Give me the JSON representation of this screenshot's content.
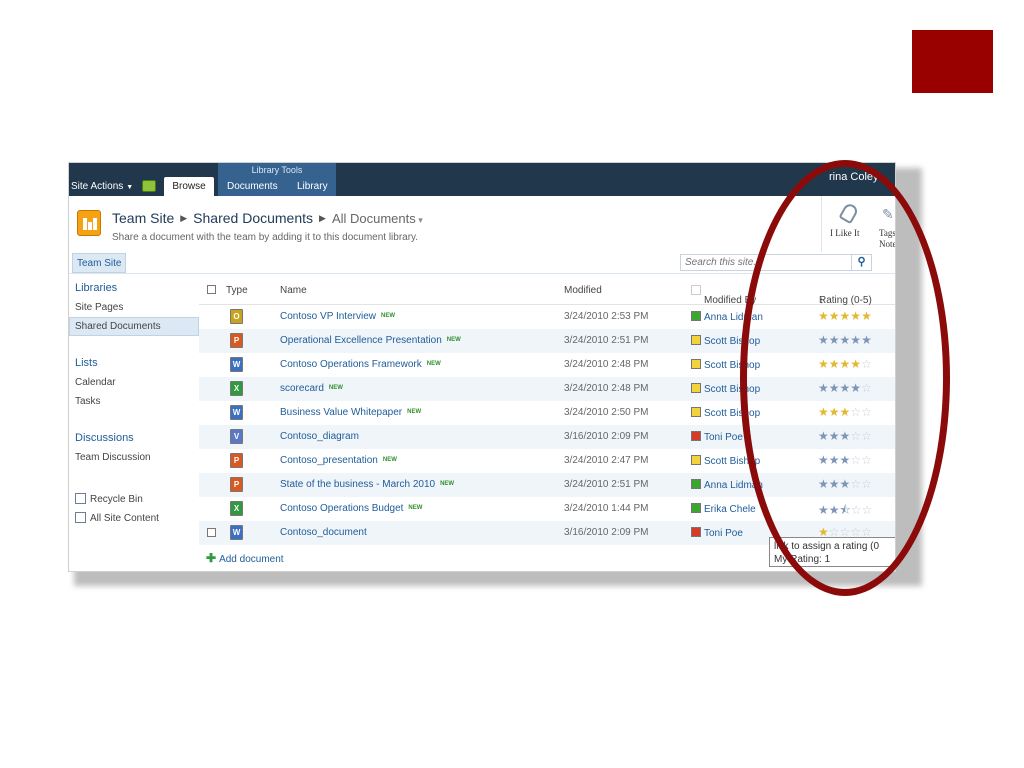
{
  "ribbon": {
    "site_actions": "Site Actions",
    "tabs_group_label": "Library Tools",
    "tab_browse": "Browse",
    "tab_documents": "Documents",
    "tab_library": "Library",
    "user_name": "rina Coley"
  },
  "title_area": {
    "breadcrumb_site": "Team Site",
    "breadcrumb_library": "Shared Documents",
    "breadcrumb_view": "All Documents",
    "description": "Share a document with the team by adding it to this document library.",
    "like_label": "I Like It",
    "tags_label_1": "Tags",
    "tags_label_2": "Note"
  },
  "topnav": {
    "tab": "Team Site",
    "search_placeholder": "Search this site..."
  },
  "leftnav": {
    "libraries_head": "Libraries",
    "site_pages": "Site Pages",
    "shared_documents": "Shared Documents",
    "lists_head": "Lists",
    "calendar": "Calendar",
    "tasks": "Tasks",
    "discussions_head": "Discussions",
    "team_discussion": "Team Discussion",
    "recycle_bin": "Recycle Bin",
    "all_site_content": "All Site Content"
  },
  "list": {
    "columns": {
      "type": "Type",
      "name": "Name",
      "modified": "Modified",
      "modified_by": "Modified By",
      "rating": "Rating (0-5)"
    },
    "new_tag": "NEW",
    "rows": [
      {
        "name": "Contoso VP Interview",
        "new": true,
        "modified": "3/24/2010 2:53 PM",
        "modified_by": "Anna Lidman",
        "presence": "#3aa52f",
        "type": "gen",
        "rating": 5,
        "rating_gold": true
      },
      {
        "name": "Operational Excellence Presentation",
        "new": true,
        "modified": "3/24/2010 2:51 PM",
        "modified_by": "Scott Bishop",
        "presence": "#f3d33b",
        "type": "ppt",
        "rating": 5,
        "rating_gold": false
      },
      {
        "name": "Contoso Operations Framework",
        "new": true,
        "modified": "3/24/2010 2:48 PM",
        "modified_by": "Scott Bishop",
        "presence": "#f3d33b",
        "type": "word",
        "rating": 4,
        "rating_gold": true
      },
      {
        "name": "scorecard",
        "new": true,
        "modified": "3/24/2010 2:48 PM",
        "modified_by": "Scott Bishop",
        "presence": "#f3d33b",
        "type": "xls",
        "rating": 4,
        "rating_gold": false
      },
      {
        "name": "Business Value Whitepaper",
        "new": true,
        "modified": "3/24/2010 2:50 PM",
        "modified_by": "Scott Bishop",
        "presence": "#f3d33b",
        "type": "word",
        "rating": 3,
        "rating_gold": true
      },
      {
        "name": "Contoso_diagram",
        "new": false,
        "modified": "3/16/2010 2:09 PM",
        "modified_by": "Toni Poe",
        "presence": "#d63a2a",
        "type": "vsd",
        "rating": 3,
        "rating_gold": false
      },
      {
        "name": "Contoso_presentation",
        "new": true,
        "modified": "3/24/2010 2:47 PM",
        "modified_by": "Scott Bishop",
        "presence": "#f3d33b",
        "type": "ppt",
        "rating": 3,
        "rating_gold": false
      },
      {
        "name": "State of the business - March 2010",
        "new": true,
        "modified": "3/24/2010 2:51 PM",
        "modified_by": "Anna Lidman",
        "presence": "#3aa52f",
        "type": "ppt",
        "rating": 3,
        "rating_gold": false
      },
      {
        "name": "Contoso Operations Budget",
        "new": true,
        "modified": "3/24/2010 1:44 PM",
        "modified_by": "Erika Chele",
        "presence": "#3aa52f",
        "type": "xls",
        "rating": 2.5,
        "rating_gold": false
      },
      {
        "name": "Contoso_document",
        "new": false,
        "modified": "3/16/2010 2:09 PM",
        "modified_by": "Toni Poe",
        "presence": "#d63a2a",
        "type": "word",
        "rating": 1,
        "rating_gold": true
      }
    ],
    "add_document": "Add document"
  },
  "tooltip": {
    "line1": "lick to assign a rating (0",
    "line2": "My Rating:  1"
  },
  "colors": {
    "accent_square": "#990000",
    "highlight_oval": "#8b0b0b",
    "ribbon": "#21374c",
    "link": "#1f5c99"
  }
}
